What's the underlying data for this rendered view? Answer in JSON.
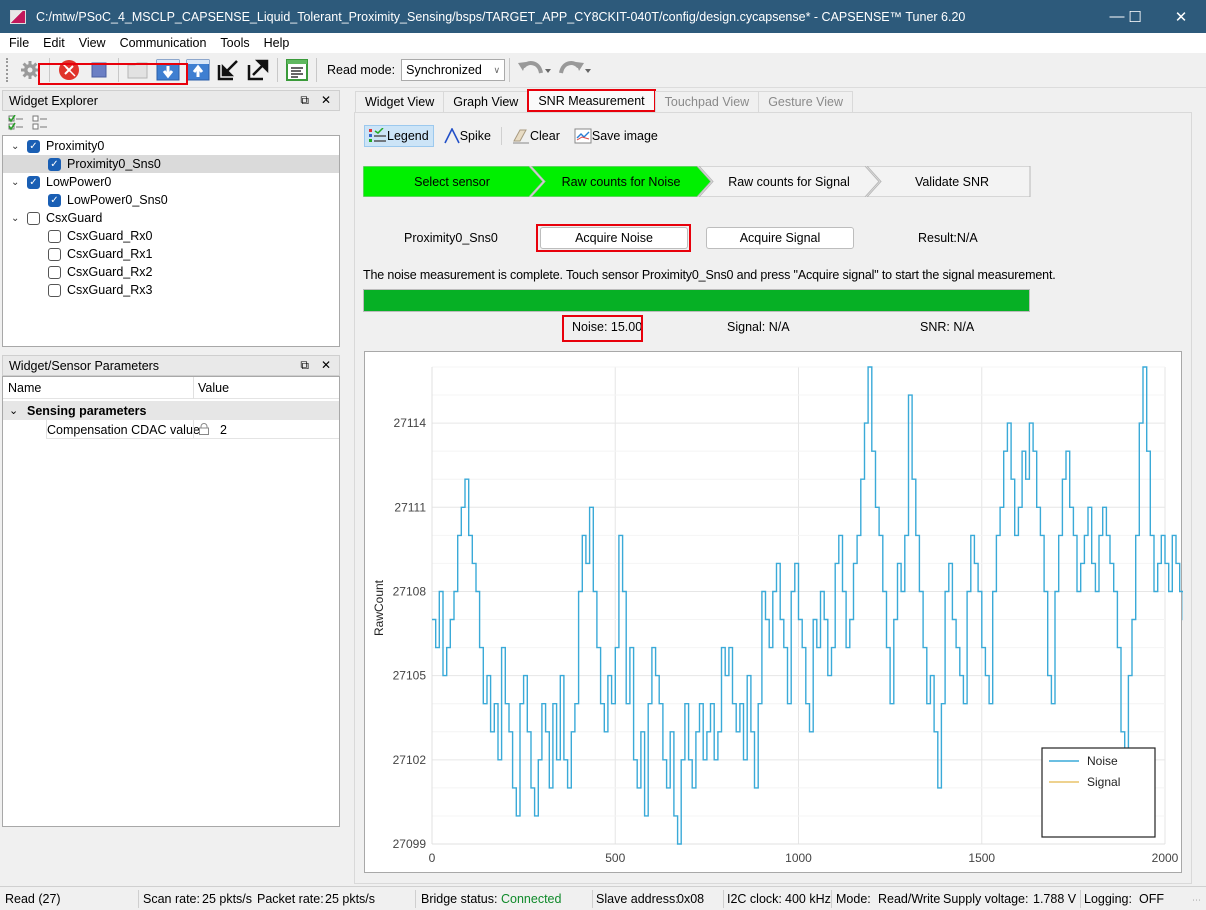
{
  "window": {
    "title": "C:/mtw/PSoC_4_MSCLP_CAPSENSE_Liquid_Tolerant_Proximity_Sensing/bsps/TARGET_APP_CY8CKIT-040T/config/design.cycapsense* - CAPSENSE™ Tuner 6.20",
    "minimize": "—",
    "maximize": "☐",
    "close": "✕"
  },
  "menu": [
    "File",
    "Edit",
    "View",
    "Communication",
    "Tools",
    "Help"
  ],
  "toolbar": {
    "icons": [
      "gear-icon",
      "disconnect-icon",
      "stop-icon",
      "open-folder-icon",
      "read-from-device-icon",
      "write-to-device-icon",
      "import-icon",
      "export-icon",
      "log-icon"
    ],
    "read_mode_label": "Read mode:",
    "read_mode_value": "Synchronized",
    "undo": "↶",
    "redo": "↷"
  },
  "widget_explorer": {
    "title": "Widget Explorer",
    "tree": [
      {
        "label": "Proximity0",
        "level": 0,
        "checked": true,
        "expanded": true
      },
      {
        "label": "Proximity0_Sns0",
        "level": 1,
        "checked": true,
        "selected": true
      },
      {
        "label": "LowPower0",
        "level": 0,
        "checked": true,
        "expanded": true
      },
      {
        "label": "LowPower0_Sns0",
        "level": 1,
        "checked": true
      },
      {
        "label": "CsxGuard",
        "level": 0,
        "checked": false,
        "expanded": true
      },
      {
        "label": "CsxGuard_Rx0",
        "level": 1,
        "checked": false
      },
      {
        "label": "CsxGuard_Rx1",
        "level": 1,
        "checked": false
      },
      {
        "label": "CsxGuard_Rx2",
        "level": 1,
        "checked": false
      },
      {
        "label": "CsxGuard_Rx3",
        "level": 1,
        "checked": false
      }
    ]
  },
  "sensor_params": {
    "title": "Widget/Sensor Parameters",
    "col_name": "Name",
    "col_value": "Value",
    "group": "Sensing parameters",
    "rows": [
      {
        "name": "Compensation CDAC value",
        "value": "2",
        "locked": true
      }
    ]
  },
  "tabs": [
    {
      "label": "Widget View",
      "state": "normal"
    },
    {
      "label": "Graph View",
      "state": "normal"
    },
    {
      "label": "SNR Measurement",
      "state": "active"
    },
    {
      "label": "Touchpad View",
      "state": "disabled"
    },
    {
      "label": "Gesture View",
      "state": "disabled"
    }
  ],
  "snr_toolbar": {
    "legend": "Legend",
    "spike": "Spike",
    "clear": "Clear",
    "save_image": "Save image"
  },
  "wizard": {
    "steps": [
      {
        "label": "Select sensor",
        "done": true
      },
      {
        "label": "Raw counts for Noise",
        "done": true
      },
      {
        "label": "Raw counts for Signal",
        "done": false
      },
      {
        "label": "Validate SNR",
        "done": false
      }
    ]
  },
  "measure": {
    "sensor": "Proximity0_Sns0",
    "acquire_noise": "Acquire Noise",
    "acquire_signal": "Acquire Signal",
    "result": "Result:N/A",
    "message": "The noise measurement is complete. Touch sensor Proximity0_Sns0 and press \"Acquire signal\" to start the signal measurement.",
    "progress_percent": 100,
    "noise": "Noise:  15.00",
    "signal": "Signal:  N/A",
    "snr": "SNR:  N/A"
  },
  "colors": {
    "accent_highlight": "#e8000b",
    "wizard_done": "#00f000",
    "progress": "#06b025",
    "noise_line": "#3aaad8",
    "signal_line": "#e8c46a",
    "titlebar": "#2d5a7b",
    "connected": "#0f8a2a"
  },
  "chart_data": {
    "type": "line",
    "title": "",
    "xlabel": "",
    "ylabel": "RawCount",
    "xlim": [
      0,
      2000
    ],
    "ylim": [
      27099,
      27116
    ],
    "x_ticks": [
      0,
      500,
      1000,
      1500,
      2000
    ],
    "y_ticks": [
      27099,
      27102,
      27105,
      27108,
      27111,
      27114
    ],
    "grid": true,
    "legend_position": "bottom-right",
    "series": [
      {
        "name": "Noise",
        "step": true,
        "x_step": 10,
        "values": [
          27107,
          27106,
          27108,
          27105,
          27106,
          27107,
          27108,
          27110,
          27111,
          27112,
          27110,
          27109,
          27108,
          27106,
          27104,
          27105,
          27103,
          27104,
          27102,
          27106,
          27104,
          27103,
          27101,
          27100,
          27104,
          27105,
          27103,
          27101,
          27100,
          27102,
          27104,
          27103,
          27101,
          27104,
          27102,
          27105,
          27102,
          27101,
          27103,
          27104,
          27108,
          27110,
          27109,
          27111,
          27108,
          27106,
          27104,
          27103,
          27105,
          27104,
          27106,
          27110,
          27108,
          27104,
          27106,
          27102,
          27101,
          27103,
          27100,
          27104,
          27106,
          27105,
          27104,
          27102,
          27101,
          27103,
          27100,
          27099,
          27102,
          27104,
          27102,
          27101,
          27103,
          27104,
          27102,
          27103,
          27104,
          27102,
          27103,
          27106,
          27105,
          27106,
          27104,
          27103,
          27104,
          27102,
          27105,
          27103,
          27101,
          27104,
          27108,
          27107,
          27106,
          27108,
          27109,
          27107,
          27106,
          27104,
          27108,
          27109,
          27107,
          27106,
          27104,
          27103,
          27107,
          27106,
          27108,
          27107,
          27105,
          27106,
          27109,
          27110,
          27108,
          27106,
          27107,
          27109,
          27110,
          27112,
          27114,
          27116,
          27113,
          27111,
          27110,
          27108,
          27106,
          27104,
          27107,
          27109,
          27108,
          27110,
          27115,
          27112,
          27110,
          27108,
          27106,
          27104,
          27105,
          27103,
          27101,
          27104,
          27108,
          27109,
          27107,
          27106,
          27105,
          27104,
          27108,
          27110,
          27109,
          27108,
          27106,
          27105,
          27104,
          27108,
          27110,
          27111,
          27113,
          27114,
          27112,
          27110,
          27111,
          27113,
          27112,
          27114,
          27113,
          27111,
          27110,
          27108,
          27105,
          27104,
          27108,
          27110,
          27112,
          27113,
          27111,
          27110,
          27108,
          27109,
          27110,
          27111,
          27109,
          27108,
          27110,
          27111,
          27110,
          27109,
          27108,
          27106,
          27103,
          27102,
          27105,
          27107,
          27110,
          27114,
          27116,
          27113,
          27110,
          27108,
          27109,
          27110,
          27109,
          27108,
          27110,
          27109,
          27108,
          27107,
          27108,
          27109,
          27107,
          27112
        ]
      },
      {
        "name": "Signal",
        "values": []
      }
    ]
  },
  "statusbar": {
    "read": "Read (27)",
    "scan_rate_label": "Scan rate:",
    "scan_rate": "25 pkts/s",
    "packet_rate_label": "Packet rate:",
    "packet_rate": "25 pkts/s",
    "bridge_label": "Bridge status:",
    "bridge": "Connected",
    "slave_label": "Slave address:",
    "slave": "0x08",
    "i2c_label": "I2C clock:",
    "i2c": "400 kHz",
    "mode_label": "Mode:",
    "mode": "Read/Write",
    "supply_label": "Supply voltage:",
    "supply": "1.788 V",
    "logging_label": "Logging:",
    "logging": "OFF"
  }
}
